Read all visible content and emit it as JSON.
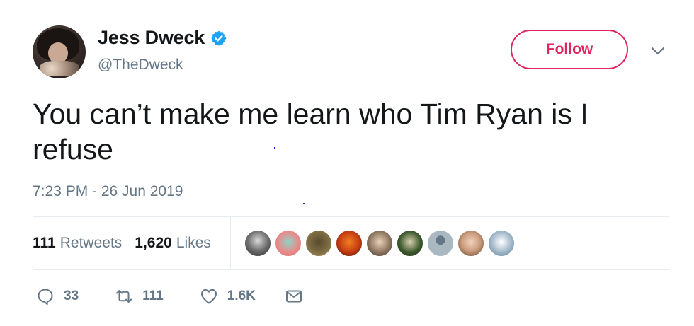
{
  "user": {
    "display_name": "Jess Dweck",
    "handle": "@TheDweck",
    "verified_icon": "verified-badge-icon",
    "verified_color": "#1da1f2"
  },
  "follow": {
    "label": "Follow",
    "color": "#e0245e"
  },
  "menu_icon": "chevron-down-icon",
  "tweet": {
    "text": "You can’t make me learn who Tim Ryan is I refuse",
    "timestamp": "7:23 PM - 26 Jun 2019"
  },
  "stats": {
    "retweets_count": "111",
    "retweets_label": "Retweets",
    "likes_count": "1,620",
    "likes_label": "Likes"
  },
  "likers": [
    {
      "name": "liker-avatar-1",
      "color": "#8e8e8e"
    },
    {
      "name": "liker-avatar-2",
      "color": "#e98a8a"
    },
    {
      "name": "liker-avatar-3",
      "color": "#7a6a40"
    },
    {
      "name": "liker-avatar-4",
      "color": "#c43b12"
    },
    {
      "name": "liker-avatar-5",
      "color": "#8d7560"
    },
    {
      "name": "liker-avatar-6",
      "color": "#3e5a2e"
    },
    {
      "name": "liker-avatar-7",
      "color": "#aab8c2"
    },
    {
      "name": "liker-avatar-8",
      "color": "#c99a7c"
    },
    {
      "name": "liker-avatar-9",
      "color": "#9fb6c9"
    }
  ],
  "actions": {
    "reply_icon": "reply-icon",
    "reply_count": "33",
    "retweet_icon": "retweet-icon",
    "retweet_count": "111",
    "like_icon": "heart-icon",
    "like_count": "1.6K",
    "dm_icon": "envelope-icon"
  },
  "colors": {
    "text": "#14171a",
    "secondary": "#657786",
    "divider": "#e6ecf0"
  }
}
